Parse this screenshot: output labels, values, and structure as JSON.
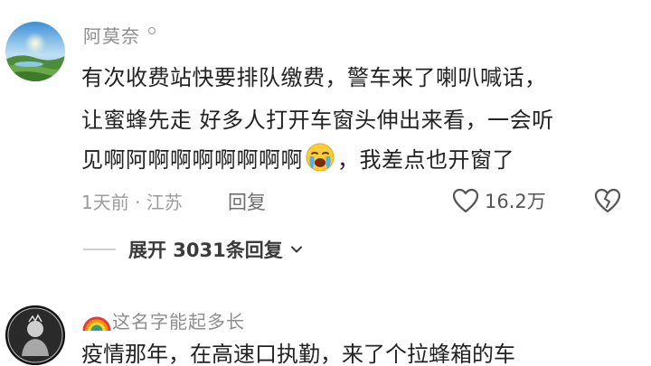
{
  "comments": [
    {
      "username": "阿莫奈",
      "lines": [
        "有次收费站快要排队缴费，警车来了喇叭喊话，",
        "让蜜蜂先走 好多人打开车窗头伸出来看，一会听",
        "见啊阿啊啊啊啊啊啊啊"
      ],
      "line3_suffix": "，我差点也开窗了",
      "meta": "1天前 · 江苏",
      "reply_label": "回复",
      "like_count": "16.2万",
      "expand_label": "展开 3031条回复"
    },
    {
      "username": "这名字能起多长",
      "partial_line": "疫情那年，在高速口执勤，来了个拉蜂箱的车"
    }
  ],
  "icons": {
    "avatar_1": "landscape-avatar",
    "vip_badge": "circle-icon",
    "emoji": "loudly-crying-face",
    "like": "heart-outline-icon",
    "dislike": "broken-heart-icon",
    "expand": "chevron-down-icon",
    "username_prefix": "rainbow-icon",
    "avatar_2": "dark-portrait-avatar"
  },
  "colors": {
    "text_primary": "#222222",
    "text_secondary": "#9b9b9b",
    "username": "#8d8d8d"
  }
}
